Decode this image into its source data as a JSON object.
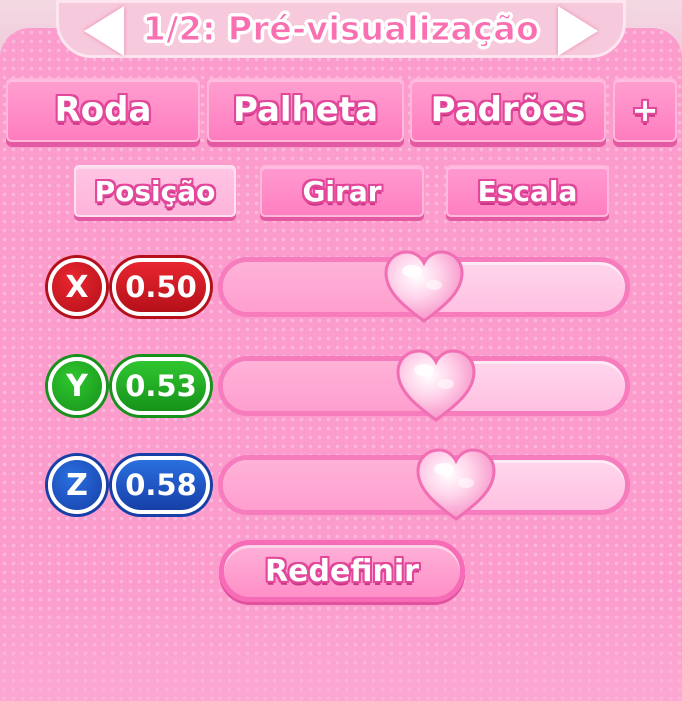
{
  "header": {
    "title": "1/2: Pré-visualização",
    "prev_icon": "arrow-left-icon",
    "next_icon": "arrow-right-icon"
  },
  "tabs": [
    {
      "label": "Roda"
    },
    {
      "label": "Palheta"
    },
    {
      "label": "Padrões"
    },
    {
      "label": "+"
    }
  ],
  "subtabs": [
    {
      "label": "Posição",
      "active": true
    },
    {
      "label": "Girar",
      "active": false
    },
    {
      "label": "Escala",
      "active": false
    }
  ],
  "axes": [
    {
      "axis": "X",
      "value": "0.50",
      "level": 0.5,
      "color": "#e8262f",
      "dark": "#b5101a"
    },
    {
      "axis": "Y",
      "value": "0.53",
      "level": 0.53,
      "color": "#2fc62f",
      "dark": "#17921a"
    },
    {
      "axis": "Z",
      "value": "0.58",
      "level": 0.58,
      "color": "#2a6fe0",
      "dark": "#163fa8"
    }
  ],
  "thumb_icon": "heart-icon",
  "reset_label": "Redefinir"
}
